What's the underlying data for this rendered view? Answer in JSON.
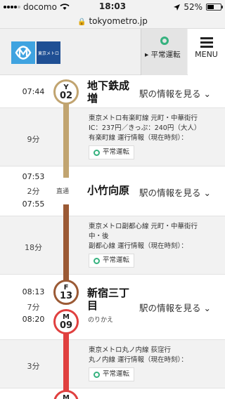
{
  "status_bar": {
    "carrier": "docomo",
    "time": "18:03",
    "battery": "52%"
  },
  "url_bar": {
    "lock": "lock-icon",
    "host": "tokyometro.jp"
  },
  "header": {
    "logo_text": "東京メトロ",
    "service_status_label": "平常運転",
    "menu_label": "MENU"
  },
  "route": {
    "stations": [
      {
        "time": "07:44",
        "line_letter": "Y",
        "number": "02",
        "name": "地下鉄成増",
        "name_line2": "増",
        "info_link": "駅の情報を見る",
        "badge_color": "#c1a470"
      },
      {
        "time_arr": "07:53",
        "time_dep": "07:55",
        "stop_min": "2分",
        "tag": "直通",
        "name": "小竹向原",
        "info_link": "駅の情報を見る"
      },
      {
        "time_arr": "08:13",
        "time_dep": "08:20",
        "stop_min": "7分",
        "line_letter": "F",
        "number": "13",
        "name": "新宿三丁目",
        "name_line1": "新宿三丁",
        "name_line2": "目",
        "note": "のりかえ",
        "info_link": "駅の情報を見る",
        "badge_color": "#9b5a35"
      },
      {
        "line_letter": "M",
        "number": "09",
        "badge_color": "#e0403f"
      }
    ],
    "segments": [
      {
        "minutes": "9分",
        "desc1": "東京メトロ有楽町線 元町・中華街行",
        "desc2": "IC：237円／きっぷ：240円（大人）",
        "desc3": "有楽町線 運行情報（現在時刻）：",
        "status": "平常運転",
        "line_color": "#c1a470"
      },
      {
        "minutes": "18分",
        "desc1": "東京メトロ副都心線 元町・中華街行",
        "desc2": "中・後",
        "desc3": "副都心線 運行情報（現在時刻）：",
        "status": "平常運転",
        "line_color": "#9b5a35"
      },
      {
        "minutes": "3分",
        "desc1": "東京メトロ丸ノ内線 荻窪行",
        "desc3": "丸ノ内線 運行情報（現在時刻）：",
        "status": "平常運転",
        "line_color": "#e0403f"
      }
    ]
  }
}
